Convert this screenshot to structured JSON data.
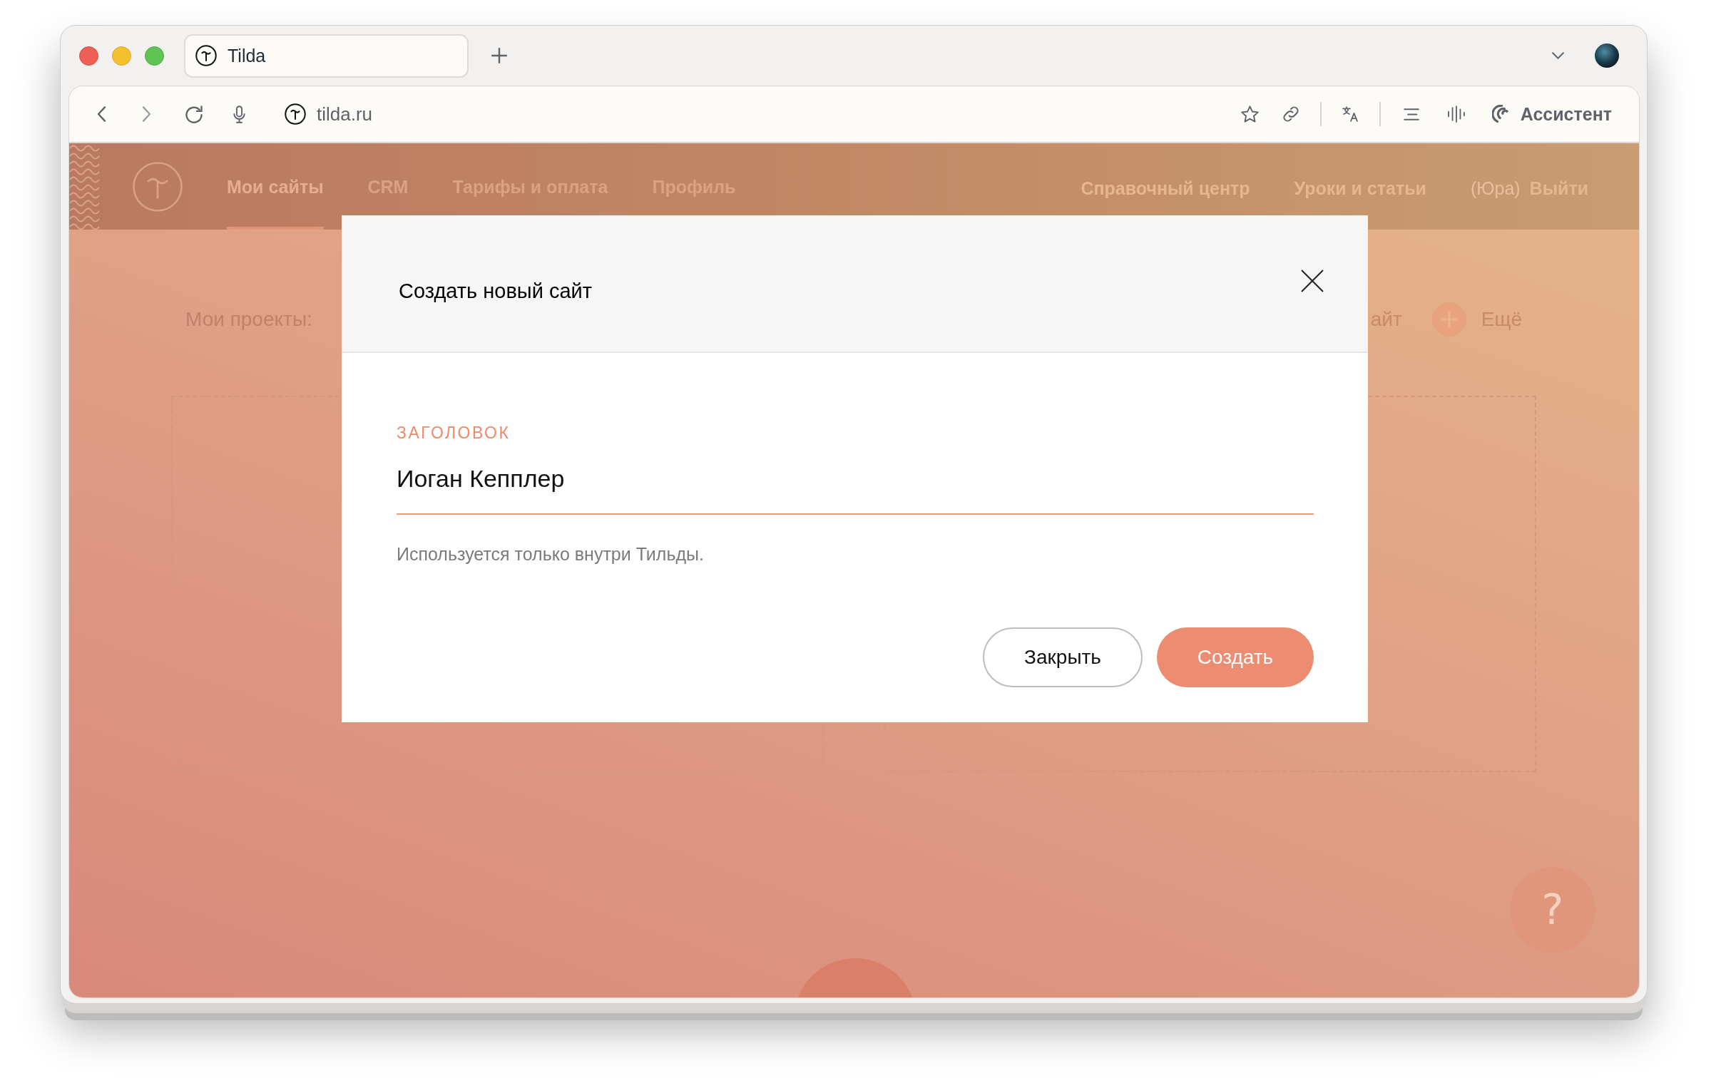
{
  "browser": {
    "tab": {
      "title": "Tilda"
    },
    "address": "tilda.ru",
    "assistant": "Ассистент"
  },
  "nav": {
    "items": [
      {
        "label": "Мои сайты",
        "selected": true
      },
      {
        "label": "CRM",
        "selected": false
      },
      {
        "label": "Тарифы и оплата",
        "selected": false
      },
      {
        "label": "Профиль",
        "selected": false
      }
    ],
    "links": [
      "Справочный центр",
      "Уроки и статьи"
    ],
    "user": "(Юра)",
    "logout": "Выйти"
  },
  "page": {
    "projects_label": "Мои проекты:",
    "covered_action": "айт",
    "more": "Ещё",
    "help_button": "?"
  },
  "modal": {
    "title": "Создать новый сайт",
    "field": {
      "label": "ЗАГОЛОВОК",
      "value": "Иоган Кепплер"
    },
    "hint": "Используется только внутри Тильды.",
    "buttons": [
      {
        "label": "Закрыть",
        "kind": "secondary"
      },
      {
        "label": "Создать",
        "kind": "primary"
      }
    ]
  }
}
